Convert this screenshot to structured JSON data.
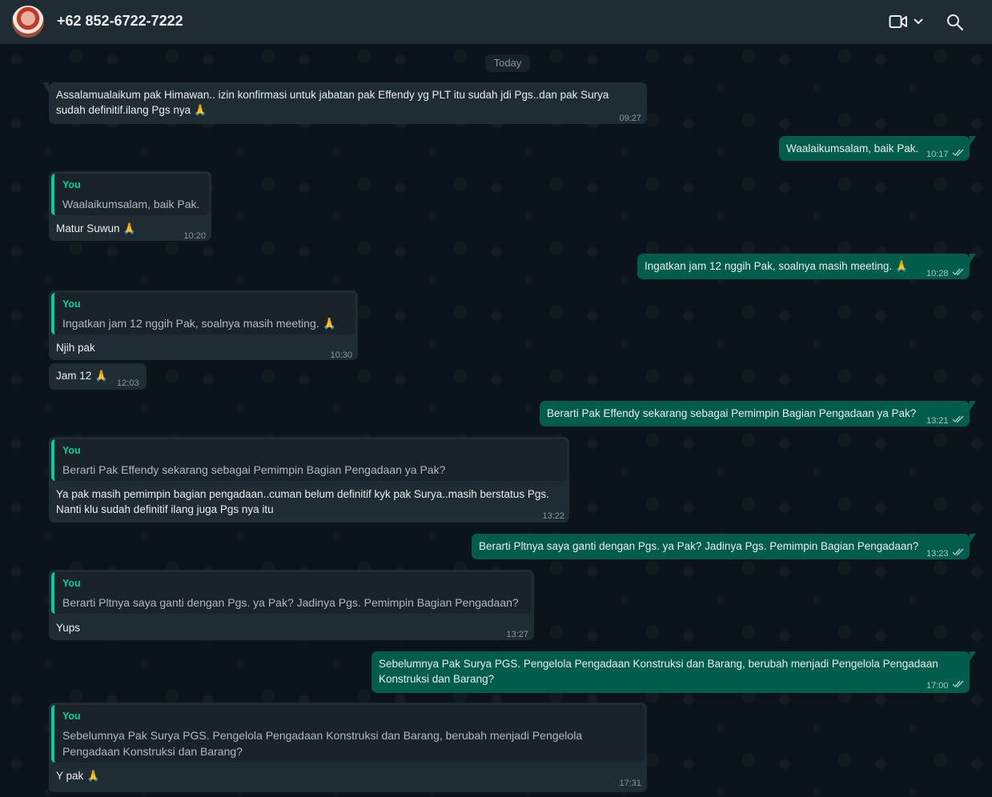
{
  "header": {
    "contact": "+62 852-6722-7222"
  },
  "date_chip": "Today",
  "messages": {
    "m1": {
      "line1": "Assalamualaikum pak Himawan.. izin konfirmasi untuk jabatan pak Effendy yg PLT itu sudah jdi Pgs..dan pak Surya",
      "line2": "sudah definitif.ilang Pgs nya 🙏",
      "time": "09:27"
    },
    "m2": {
      "text": "Waalaikumsalam, baik Pak.",
      "time": "10:17"
    },
    "m3": {
      "quote_author": "You",
      "quote_text": "Waalaikumsalam, baik Pak.",
      "text": "Matur Suwun 🙏",
      "time": "10:20"
    },
    "m4": {
      "text": "Ingatkan jam 12 nggih Pak, soalnya masih meeting. 🙏",
      "time": "10:28"
    },
    "m5": {
      "quote_author": "You",
      "quote_text": "Ingatkan jam 12 nggih Pak, soalnya masih meeting. 🙏",
      "text": "Njih pak",
      "time": "10:30"
    },
    "m6": {
      "text": "Jam 12 🙏",
      "time": "12:03"
    },
    "m7": {
      "text": "Berarti Pak Effendy sekarang sebagai Pemimpin Bagian Pengadaan ya Pak?",
      "time": "13:21"
    },
    "m8": {
      "quote_author": "You",
      "quote_text": "Berarti Pak Effendy sekarang sebagai Pemimpin Bagian Pengadaan ya Pak?",
      "line1": "Ya pak masih pemimpin bagian pengadaan..cuman belum definitif kyk pak Surya..masih berstatus Pgs.",
      "line2": "Nanti klu sudah definitif ilang juga Pgs nya itu",
      "time": "13:22"
    },
    "m9": {
      "text": "Berarti Pltnya saya ganti dengan Pgs. ya Pak? Jadinya Pgs. Pemimpin Bagian Pengadaan?",
      "time": "13:23"
    },
    "m10": {
      "quote_author": "You",
      "quote_text": "Berarti Pltnya saya ganti dengan Pgs. ya Pak? Jadinya Pgs. Pemimpin Bagian Pengadaan?",
      "text": "Yups",
      "time": "13:27"
    },
    "m11": {
      "line1": "Sebelumnya Pak Surya PGS. Pengelola Pengadaan Konstruksi dan Barang, berubah menjadi Pengelola Pengadaan",
      "line2": "Konstruksi dan Barang?",
      "time": "17:00"
    },
    "m12": {
      "quote_author": "You",
      "quote_line1": "Sebelumnya Pak Surya PGS. Pengelola Pengadaan Konstruksi dan Barang, berubah menjadi Pengelola",
      "quote_line2": "Pengadaan Konstruksi dan Barang?",
      "text": "Y pak 🙏",
      "time": "17:31"
    }
  },
  "icons": {
    "video": "video-call-icon",
    "dropdown": "chevron-down-icon",
    "search": "search-icon",
    "read": "double-check-icon"
  },
  "colors": {
    "incoming_bubble": "#202c33",
    "outgoing_bubble": "#005c4b",
    "quote_accent": "#06cf9c",
    "read_check": "#53bdeb"
  }
}
